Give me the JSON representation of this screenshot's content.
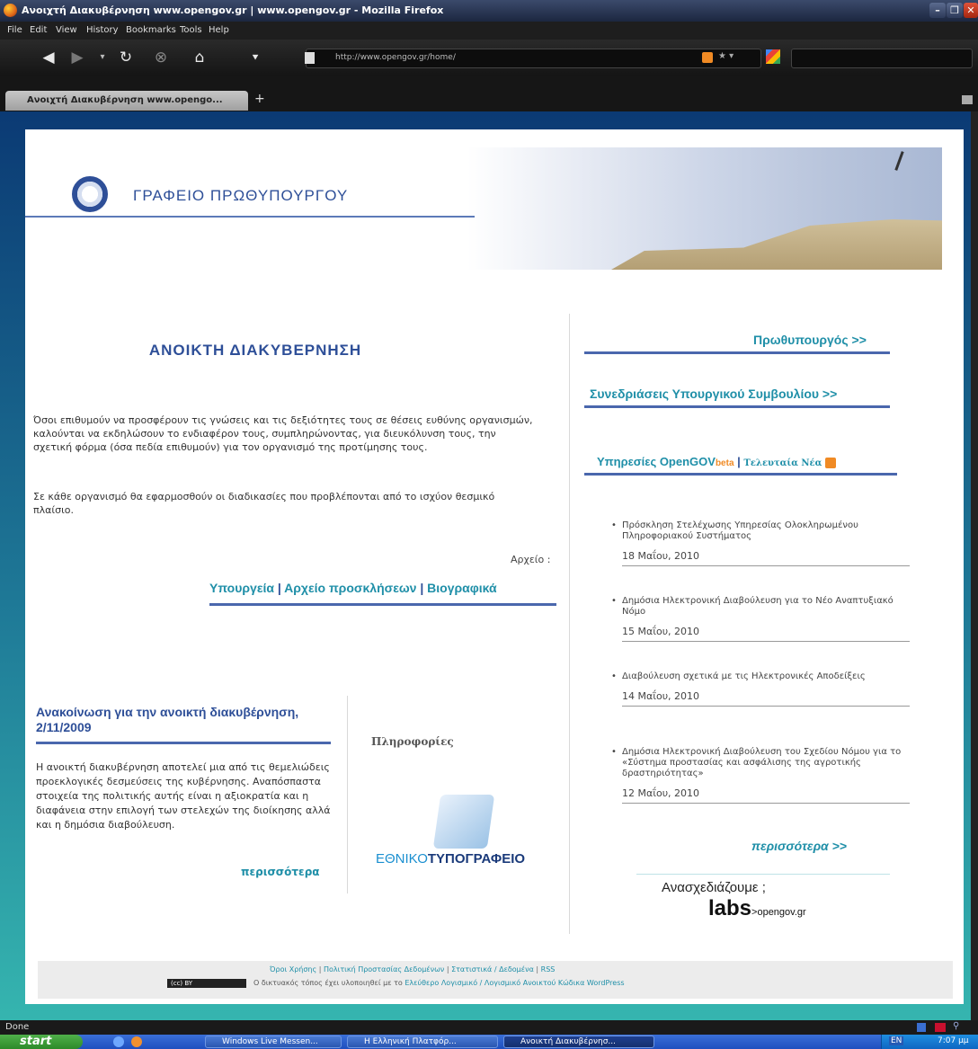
{
  "browser": {
    "window_title": "Ανοιχτή Διακυβέρνηση www.opengov.gr | www.opengov.gr - Mozilla Firefox",
    "menu": [
      "File",
      "Edit",
      "View",
      "History",
      "Bookmarks",
      "Tools",
      "Help"
    ],
    "url": "http://www.opengov.gr/home/",
    "tab_title": "Ανοιχτή Διακυβέρνηση www.opengo...",
    "new_tab": "+",
    "status": "Done"
  },
  "site": {
    "header_title": "ΓΡΑΦΕΙΟ ΠΡΩΘΥΠΟΥΡΓΟΥ",
    "main_title": "ΑΝΟΙΚΤΗ ΔΙΑΚΥΒΕΡΝΗΣΗ",
    "intro_p1": "Όσοι επιθυμούν να προσφέρουν τις γνώσεις και τις δεξιότητες τους σε θέσεις ευθύνης οργανισμών, καλούνται να εκδηλώσουν το ενδιαφέρον τους, συμπληρώνοντας, για διευκόλυνση τους, την σχετική φόρμα (όσα πεδία επιθυμούν) για τον οργανισμό της προτίμησης τους.",
    "intro_p2": "Σε κάθε οργανισμό θα εφαρμοσθούν οι διαδικασίες που προβλέπονται από το ισχύον θεσμικό πλαίσιο.",
    "archive_label": "Αρχείο :",
    "archive_links": [
      "Υπουργεία",
      "Αρχείο προσκλήσεων",
      "Βιογραφικά"
    ],
    "separator": "|",
    "announcement_title": "Ανακοίνωση για την ανοικτή διακυβέρνηση, 2/11/2009",
    "announcement_text": "Η ανοικτή διακυβέρνηση αποτελεί μια από τις θεμελιώδεις προεκλογικές δεσμεύσεις της κυβέρνησης. Αναπόσπαστα στοιχεία της πολιτικής αυτής είναι η αξιοκρατία και η διαφάνεια στην επιλογή των στελεχών της διοίκησης αλλά και η δημόσια διαβούλευση.",
    "announcement_more": "περισσότερα",
    "info_label": "Πληροφορίες",
    "typografeio_prefix": "ΕΘΝΙΚΟ",
    "typografeio_suffix": "ΤΥΠΟΓΡΑΦΕΙΟ",
    "right_link_pm": "Πρωθυπουργός >>",
    "right_link_cabinet": "Συνεδριάσεις Υπουργικού Συμβουλίου >>",
    "services_prefix": "Υπηρεσίες OpenGOV",
    "services_beta": "beta",
    "latest_news": "Τελευταία Νέα",
    "news": [
      {
        "title": "Πρόσκληση Στελέχωσης Υπηρεσίας Ολοκληρωμένου Πληροφοριακού Συστήματος",
        "date": "18 Μαΐου, 2010"
      },
      {
        "title": "Δημόσια Ηλεκτρονική Διαβούλευση για το Νέο Αναπτυξιακό Νόμο",
        "date": "15 Μαΐου, 2010"
      },
      {
        "title": "Διαβούλευση σχετικά με τις Ηλεκτρονικές Αποδείξεις",
        "date": "14 Μαΐου, 2010"
      },
      {
        "title": "Δημόσια Ηλεκτρονική Διαβούλευση του Σχεδίου Νόμου για το «Σύστημα προστασίας και ασφάλισης της αγροτικής δραστηριότητας»",
        "date": "12 Μαΐου, 2010"
      }
    ],
    "news_more": "περισσότερα >>",
    "redesign": "Ανασχεδιάζουμε ;",
    "labs": "labs",
    "labs_suffix": ">opengov.gr",
    "footer_links": [
      "Όροι Χρήσης",
      "Πολιτική Προστασίας Δεδομένων",
      "Στατιστικά / Δεδομένα",
      "RSS"
    ],
    "footer_text_prefix": "Ο δικτυακός τόπος έχει υλοποιηθεί με το",
    "footer_text_link": "Ελεύθερο Λογισμικό / Λογισμικό Ανοικτού Κώδικα WordPress",
    "cc_badge": "(cc) BY"
  },
  "taskbar": {
    "start": "start",
    "buttons": [
      "Windows Live Messen...",
      "Η Ελληνική Πλατφόρ...",
      "Ανοικτή Διακυβέρνησ..."
    ],
    "lang": "EN",
    "clock": "7:07 μμ"
  }
}
